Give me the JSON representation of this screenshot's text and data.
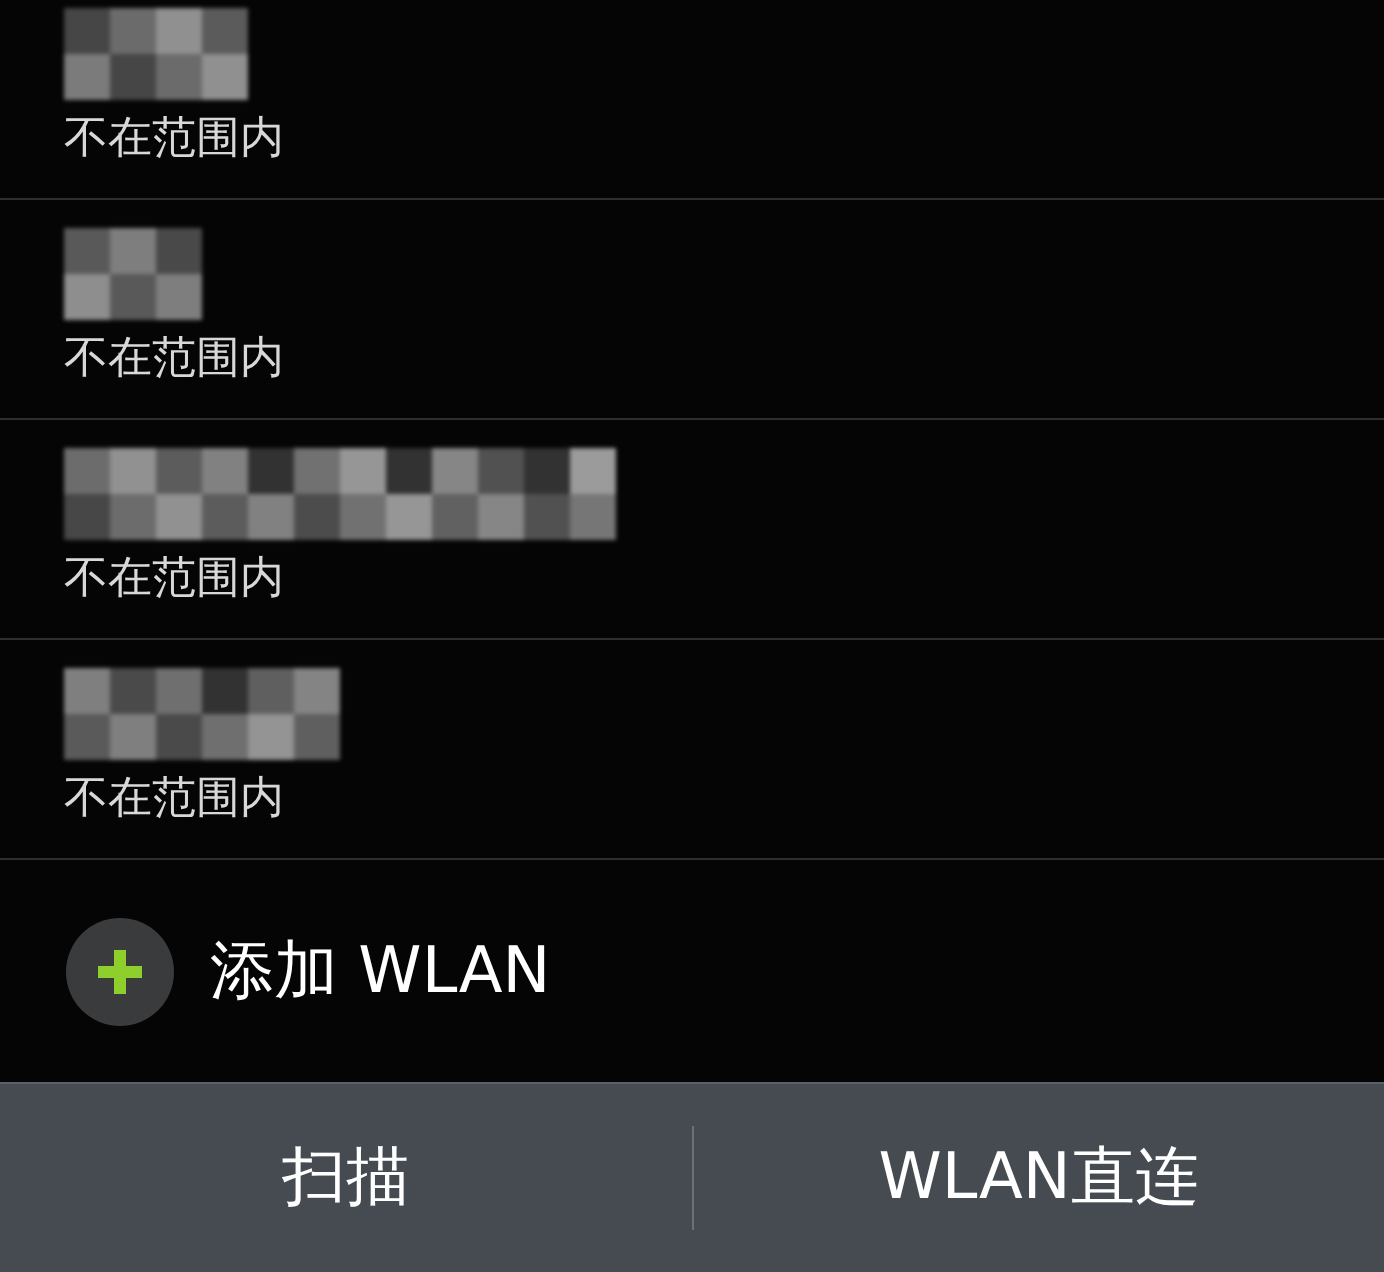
{
  "networks": [
    {
      "status": "不在范围内"
    },
    {
      "status": "不在范围内"
    },
    {
      "status": "不在范围内"
    },
    {
      "status": "不在范围内"
    }
  ],
  "add_network": {
    "label": "添加 WLAN"
  },
  "bottom_bar": {
    "buttons": [
      "扫描",
      "WLAN直连"
    ]
  }
}
